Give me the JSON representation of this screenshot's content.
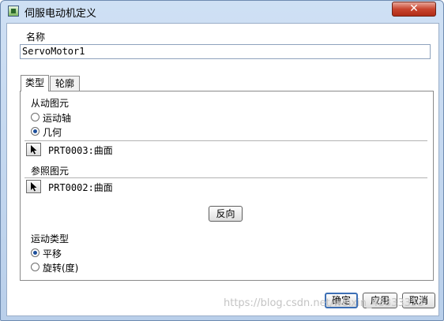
{
  "window": {
    "title": "伺服电动机定义",
    "close_glyph": "✕"
  },
  "name": {
    "label": "名称",
    "value": "ServoMotor1"
  },
  "tabs": [
    {
      "label": "类型",
      "active": true
    },
    {
      "label": "轮廓",
      "active": false
    }
  ],
  "driven_entity": {
    "label": "从动图元",
    "options": [
      {
        "label": "运动轴",
        "selected": false
      },
      {
        "label": "几何",
        "selected": true
      }
    ],
    "selection": "PRT0003:曲面"
  },
  "reference_entity": {
    "label": "参照图元",
    "selection": "PRT0002:曲面"
  },
  "flip_button": "反向",
  "motion_type": {
    "label": "运动类型",
    "options": [
      {
        "label": "平移",
        "selected": true
      },
      {
        "label": "旋转(度)",
        "selected": false
      }
    ]
  },
  "footer": {
    "ok": "确定",
    "apply": "应用",
    "cancel": "取消"
  },
  "watermark": "https://blog.csdn.net/weixin_43333353"
}
